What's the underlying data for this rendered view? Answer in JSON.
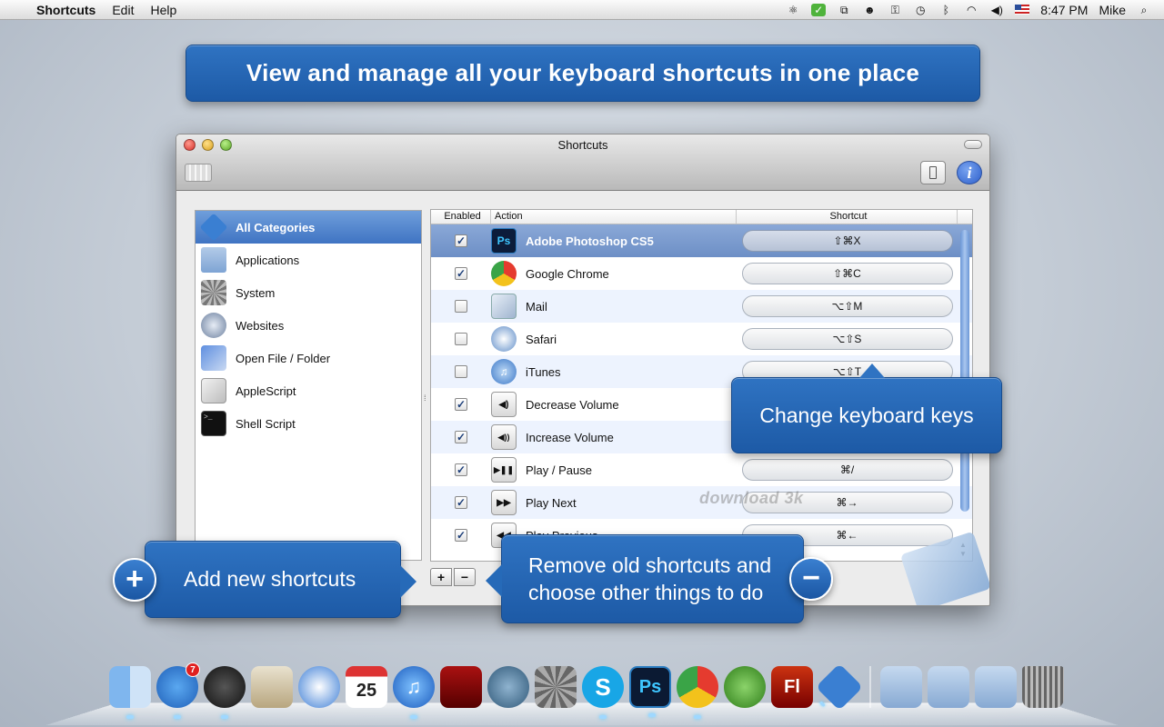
{
  "menubar": {
    "app_name": "Shortcuts",
    "menus": [
      "Edit",
      "Help"
    ],
    "time": "8:47 PM",
    "user": "Mike"
  },
  "banner": "View and manage all your keyboard shortcuts in one place",
  "window": {
    "title": "Shortcuts"
  },
  "sidebar": {
    "categories": [
      {
        "label": "All Categories",
        "icon": "all-categories-icon",
        "selected": true
      },
      {
        "label": "Applications",
        "icon": "applications-folder-icon"
      },
      {
        "label": "System",
        "icon": "system-preferences-icon"
      },
      {
        "label": "Websites",
        "icon": "websites-globe-icon"
      },
      {
        "label": "Open File / Folder",
        "icon": "finder-icon"
      },
      {
        "label": "AppleScript",
        "icon": "applescript-icon"
      },
      {
        "label": "Shell Script",
        "icon": "terminal-icon"
      }
    ]
  },
  "table": {
    "headers": {
      "enabled": "Enabled",
      "action": "Action",
      "shortcut": "Shortcut"
    },
    "rows": [
      {
        "enabled": true,
        "action": "Adobe Photoshop CS5",
        "shortcut": "⇧⌘X",
        "icon_text": "Ps",
        "selected": true
      },
      {
        "enabled": true,
        "action": "Google Chrome",
        "shortcut": "⇧⌘C",
        "icon_text": ""
      },
      {
        "enabled": false,
        "action": "Mail",
        "shortcut": "⌥⇧M",
        "icon_text": ""
      },
      {
        "enabled": false,
        "action": "Safari",
        "shortcut": "⌥⇧S",
        "icon_text": ""
      },
      {
        "enabled": false,
        "action": "iTunes",
        "shortcut": "⌥⇧T",
        "icon_text": "♫"
      },
      {
        "enabled": true,
        "action": "Decrease Volume",
        "shortcut": "",
        "icon_text": "◀)"
      },
      {
        "enabled": true,
        "action": "Increase Volume",
        "shortcut": "",
        "icon_text": "◀))"
      },
      {
        "enabled": true,
        "action": "Play / Pause",
        "shortcut": "⌘/",
        "icon_text": "▶❚❚"
      },
      {
        "enabled": true,
        "action": "Play Next",
        "shortcut": "⌘→",
        "icon_text": "▶▶"
      },
      {
        "enabled": true,
        "action": "Play Previous",
        "shortcut": "⌘←",
        "icon_text": "◀◀"
      }
    ]
  },
  "buttons": {
    "add": "+",
    "remove": "−"
  },
  "watermark": "download 3k",
  "callouts": {
    "keys": "Change keyboard keys",
    "add": "Add new shortcuts",
    "remove_line1": "Remove old shortcuts and",
    "remove_line2": "choose other things to do"
  },
  "dock": {
    "items": [
      {
        "name": "finder",
        "label": ""
      },
      {
        "name": "app-store",
        "label": "",
        "badge": "7"
      },
      {
        "name": "dashboard",
        "label": ""
      },
      {
        "name": "mail",
        "label": ""
      },
      {
        "name": "safari",
        "label": ""
      },
      {
        "name": "calendar",
        "label": "25"
      },
      {
        "name": "itunes",
        "label": "♫"
      },
      {
        "name": "photo-booth",
        "label": ""
      },
      {
        "name": "time-machine",
        "label": ""
      },
      {
        "name": "system-preferences",
        "label": ""
      },
      {
        "name": "skype",
        "label": "S"
      },
      {
        "name": "photoshop",
        "label": "Ps"
      },
      {
        "name": "chrome",
        "label": ""
      },
      {
        "name": "adium",
        "label": ""
      },
      {
        "name": "flash",
        "label": "Fl"
      },
      {
        "name": "shortcuts",
        "label": ""
      },
      {
        "name": "applications-stack",
        "label": ""
      },
      {
        "name": "documents-stack",
        "label": ""
      },
      {
        "name": "downloads-stack",
        "label": ""
      },
      {
        "name": "trash",
        "label": ""
      }
    ]
  }
}
